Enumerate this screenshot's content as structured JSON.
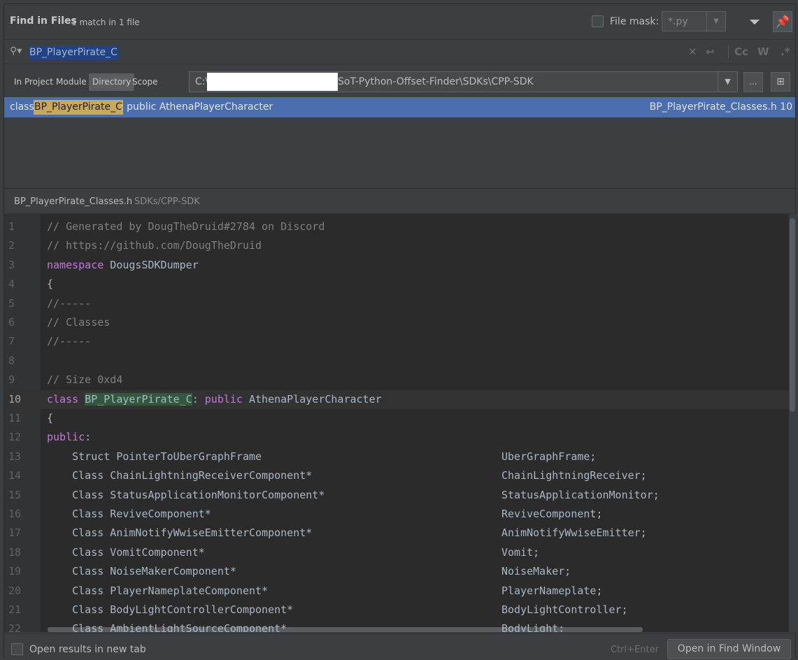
{
  "header": {
    "title": "Find in Files",
    "match_count": "1 match in 1 file",
    "file_mask_label": "File mask:",
    "file_mask_value": "*.py"
  },
  "search": {
    "query": "BP_PlayerPirate_C",
    "icons": [
      "clear-icon",
      "newline-icon",
      "match-case-icon",
      "words-icon",
      "regex-icon"
    ],
    "cc_label": "Cc",
    "w_label": "W",
    "regex_label": ".*"
  },
  "scope": {
    "tabs": [
      "In Project",
      "Module",
      "Directory",
      "Scope"
    ],
    "selected_tab": "Directory",
    "directory_prefix": "C:\\",
    "directory_suffix": "SoT-Python-Offset-Finder\\SDKs\\CPP-SDK",
    "browse_label": "..."
  },
  "results": [
    {
      "prefix": "class",
      "match": "BP_PlayerPirate_C",
      "rest": ": public AthenaPlayerCharacter",
      "file": "BP_PlayerPirate_Classes.h 10"
    }
  ],
  "preview": {
    "file_name": "BP_PlayerPirate_Classes.h",
    "file_path": "SDKs/CPP-SDK"
  },
  "code_lines": [
    {
      "n": "1",
      "text": "// Generated by DougTheDruid#2784 on Discord"
    },
    {
      "n": "2",
      "text": "// https://github.com/DougTheDruid"
    },
    {
      "n": "3",
      "kw": "namespace",
      "text": "DougsSDKDumper"
    },
    {
      "n": "4",
      "text": "{"
    },
    {
      "n": "5",
      "text": "//-----"
    },
    {
      "n": "6",
      "text": "// Classes"
    },
    {
      "n": "7",
      "text": "//-----"
    },
    {
      "n": "8",
      "text": ""
    },
    {
      "n": "9",
      "text": "// Size 0xd4"
    },
    {
      "n": "10",
      "kw": "class",
      "match": "BP_PlayerPirate_C",
      "kw2": "public",
      "text": "AthenaPlayerCharacter"
    },
    {
      "n": "11",
      "text": "{"
    },
    {
      "n": "12",
      "kw": "public",
      "text": ":"
    },
    {
      "n": "13",
      "text": "    Struct PointerToUberGraphFrame",
      "member": "UberGraphFrame;"
    },
    {
      "n": "14",
      "text": "    Class ChainLightningReceiverComponent*",
      "member": "ChainLightningReceiver;"
    },
    {
      "n": "15",
      "text": "    Class StatusApplicationMonitorComponent*",
      "member": "StatusApplicationMonitor;"
    },
    {
      "n": "16",
      "text": "    Class ReviveComponent*",
      "member": "ReviveComponent;"
    },
    {
      "n": "17",
      "text": "    Class AnimNotifyWwiseEmitterComponent*",
      "member": "AnimNotifyWwiseEmitter;"
    },
    {
      "n": "18",
      "text": "    Class VomitComponent*",
      "member": "Vomit;"
    },
    {
      "n": "19",
      "text": "    Class NoiseMakerComponent*",
      "member": "NoiseMaker;"
    },
    {
      "n": "20",
      "text": "    Class PlayerNameplateComponent*",
      "member": "PlayerNameplate;"
    },
    {
      "n": "21",
      "text": "    Class BodyLightControllerComponent*",
      "member": "BodyLightController;"
    },
    {
      "n": "22",
      "text": "    Class AmbientLightSourceComponent*",
      "member": "BodyLight;"
    }
  ],
  "footer": {
    "new_tab_label": "Open results in new tab",
    "shortcut_hint": "Ctrl+Enter",
    "open_button": "Open in Find Window"
  },
  "colors": {
    "background": "#3c3f41",
    "editor_bg": "#2b2b2b",
    "selection": "#4b6eaf",
    "keyword": "#c678dd",
    "comment": "#808080",
    "match_highlight": "#32593d"
  }
}
